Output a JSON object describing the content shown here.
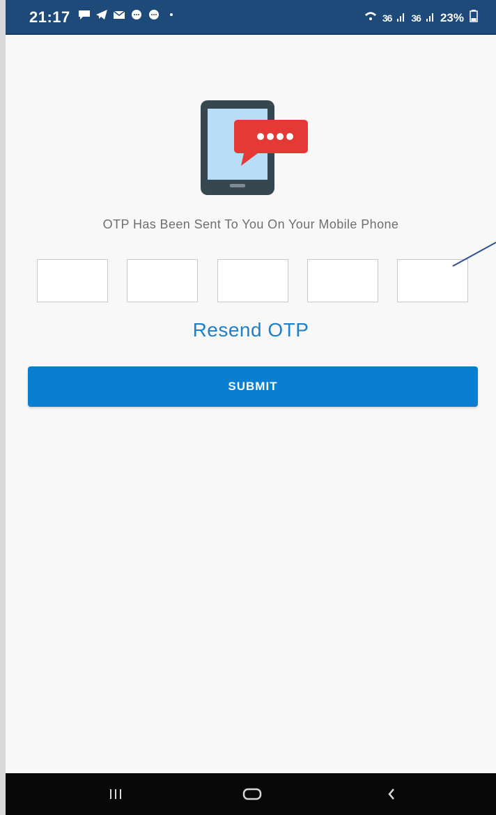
{
  "status_bar": {
    "time": "21:17",
    "notification_icons": [
      "message-icon",
      "telegram-icon",
      "mail-icon",
      "chat-icon",
      "chat-icon",
      "dot-icon"
    ],
    "signal_text_1": "36",
    "signal_text_2": "36",
    "battery": "23%"
  },
  "main": {
    "message": "OTP Has Been Sent To You On Your Mobile Phone",
    "otp_fields": [
      "",
      "",
      "",
      "",
      ""
    ],
    "resend_label": "Resend OTP",
    "submit_label": "SUBMIT"
  },
  "nav": {
    "recent_icon": "recent-apps-icon",
    "home_icon": "home-icon",
    "back_icon": "back-icon"
  },
  "colors": {
    "status_bar": "#1d4a78",
    "accent": "#0a7ed1",
    "link": "#1f7fc8",
    "phone_body": "#37474f",
    "phone_screen": "#b8ddf8",
    "bubble": "#e53935"
  }
}
